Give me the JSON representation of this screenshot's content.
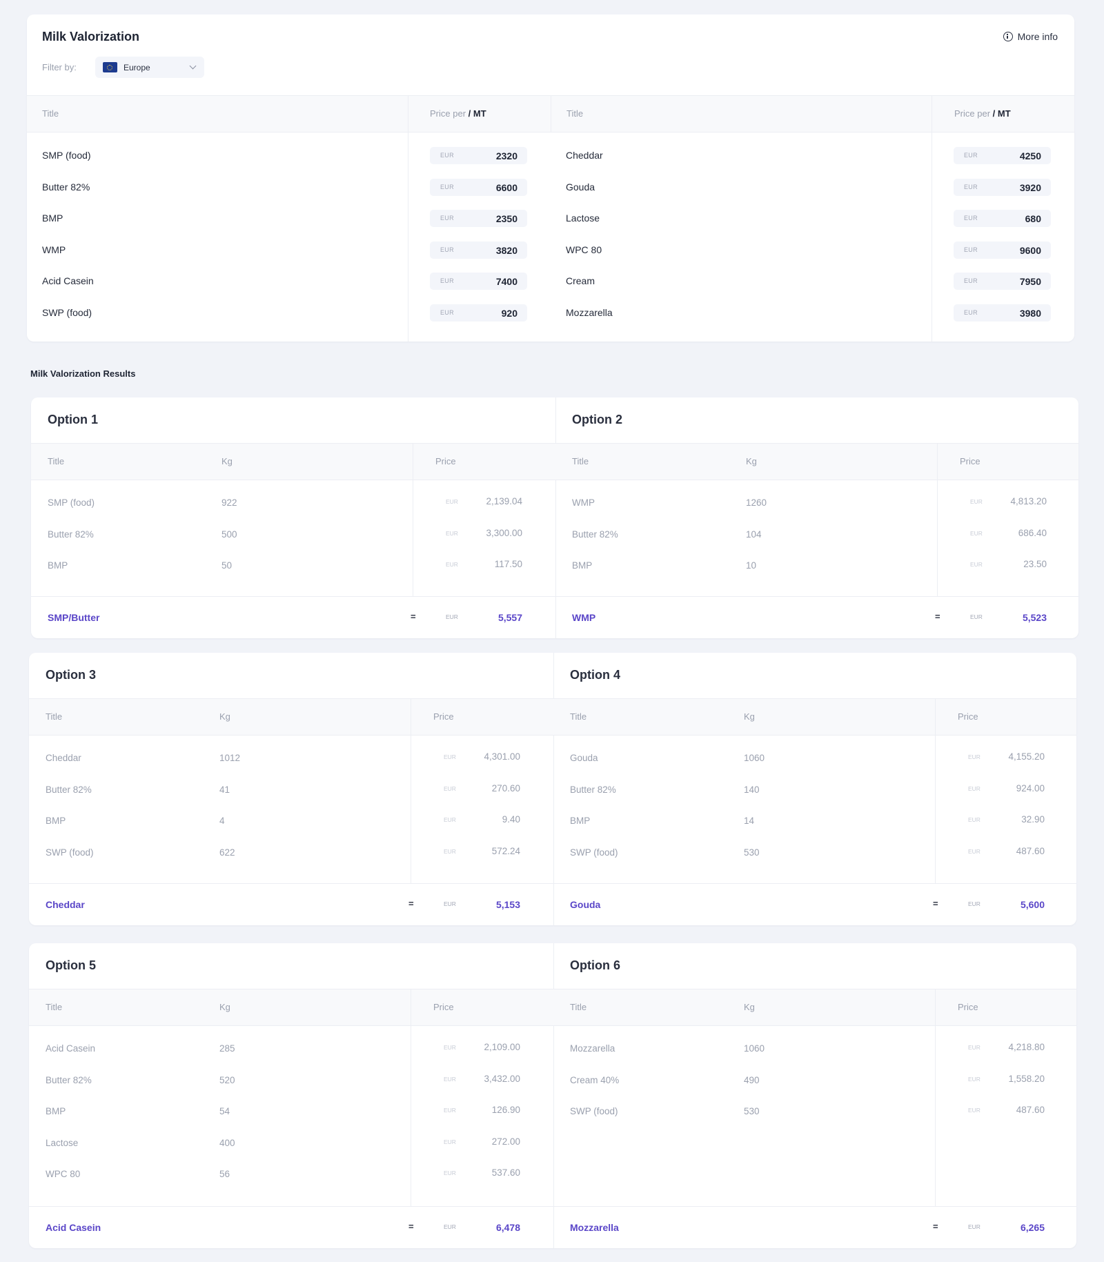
{
  "header": {
    "title": "Milk Valorization",
    "more_info": "More info",
    "filter_label": "Filter by:",
    "filter_value": "Europe",
    "filter_icon": "eu-flag-icon"
  },
  "price_tables": [
    {
      "title_header": "Title",
      "price_header_prefix": "Price per",
      "price_header_unit": "/ MT",
      "rows": [
        {
          "title": "SMP (food)",
          "currency": "EUR",
          "price": "2320"
        },
        {
          "title": "Butter 82%",
          "currency": "EUR",
          "price": "6600"
        },
        {
          "title": "BMP",
          "currency": "EUR",
          "price": "2350"
        },
        {
          "title": "WMP",
          "currency": "EUR",
          "price": "3820"
        },
        {
          "title": "Acid Casein",
          "currency": "EUR",
          "price": "7400"
        },
        {
          "title": "SWP (food)",
          "currency": "EUR",
          "price": "920"
        }
      ]
    },
    {
      "title_header": "Title",
      "price_header_prefix": "Price per",
      "price_header_unit": "/ MT",
      "rows": [
        {
          "title": "Cheddar",
          "currency": "EUR",
          "price": "4250"
        },
        {
          "title": "Gouda",
          "currency": "EUR",
          "price": "3920"
        },
        {
          "title": "Lactose",
          "currency": "EUR",
          "price": "680"
        },
        {
          "title": "WPC 80",
          "currency": "EUR",
          "price": "9600"
        },
        {
          "title": "Cream",
          "currency": "EUR",
          "price": "7950"
        },
        {
          "title": "Mozzarella",
          "currency": "EUR",
          "price": "3980"
        }
      ]
    }
  ],
  "results_heading": "Milk Valorization Results",
  "options": [
    {
      "name": "Option 1",
      "headers": {
        "title": "Title",
        "kg": "Kg",
        "price": "Price"
      },
      "rows": [
        {
          "title": "SMP (food)",
          "kg": "922",
          "currency": "EUR",
          "price": "2,139.04"
        },
        {
          "title": "Butter 82%",
          "kg": "500",
          "currency": "EUR",
          "price": "3,300.00"
        },
        {
          "title": "BMP",
          "kg": "50",
          "currency": "EUR",
          "price": "117.50"
        }
      ],
      "total": {
        "label": "SMP/Butter",
        "eq": "=",
        "currency": "EUR",
        "value": "5,557"
      }
    },
    {
      "name": "Option 2",
      "headers": {
        "title": "Title",
        "kg": "Kg",
        "price": "Price"
      },
      "rows": [
        {
          "title": "WMP",
          "kg": "1260",
          "currency": "EUR",
          "price": "4,813.20"
        },
        {
          "title": "Butter 82%",
          "kg": "104",
          "currency": "EUR",
          "price": "686.40"
        },
        {
          "title": "BMP",
          "kg": "10",
          "currency": "EUR",
          "price": "23.50"
        }
      ],
      "total": {
        "label": "WMP",
        "eq": "=",
        "currency": "EUR",
        "value": "5,523"
      }
    },
    {
      "name": "Option 3",
      "headers": {
        "title": "Title",
        "kg": "Kg",
        "price": "Price"
      },
      "rows": [
        {
          "title": "Cheddar",
          "kg": "1012",
          "currency": "EUR",
          "price": "4,301.00"
        },
        {
          "title": "Butter 82%",
          "kg": "41",
          "currency": "EUR",
          "price": "270.60"
        },
        {
          "title": "BMP",
          "kg": "4",
          "currency": "EUR",
          "price": "9.40"
        },
        {
          "title": "SWP (food)",
          "kg": "622",
          "currency": "EUR",
          "price": "572.24"
        }
      ],
      "total": {
        "label": "Cheddar",
        "eq": "=",
        "currency": "EUR",
        "value": "5,153"
      }
    },
    {
      "name": "Option 4",
      "headers": {
        "title": "Title",
        "kg": "Kg",
        "price": "Price"
      },
      "rows": [
        {
          "title": "Gouda",
          "kg": "1060",
          "currency": "EUR",
          "price": "4,155.20"
        },
        {
          "title": "Butter 82%",
          "kg": "140",
          "currency": "EUR",
          "price": "924.00"
        },
        {
          "title": "BMP",
          "kg": "14",
          "currency": "EUR",
          "price": "32.90"
        },
        {
          "title": "SWP (food)",
          "kg": "530",
          "currency": "EUR",
          "price": "487.60"
        }
      ],
      "total": {
        "label": "Gouda",
        "eq": "=",
        "currency": "EUR",
        "value": "5,600"
      }
    },
    {
      "name": "Option 5",
      "headers": {
        "title": "Title",
        "kg": "Kg",
        "price": "Price"
      },
      "rows": [
        {
          "title": "Acid Casein",
          "kg": "285",
          "currency": "EUR",
          "price": "2,109.00"
        },
        {
          "title": "Butter 82%",
          "kg": "520",
          "currency": "EUR",
          "price": "3,432.00"
        },
        {
          "title": "BMP",
          "kg": "54",
          "currency": "EUR",
          "price": "126.90"
        },
        {
          "title": "Lactose",
          "kg": "400",
          "currency": "EUR",
          "price": "272.00"
        },
        {
          "title": "WPC 80",
          "kg": "56",
          "currency": "EUR",
          "price": "537.60"
        }
      ],
      "total": {
        "label": "Acid Casein",
        "eq": "=",
        "currency": "EUR",
        "value": "6,478"
      }
    },
    {
      "name": "Option 6",
      "headers": {
        "title": "Title",
        "kg": "Kg",
        "price": "Price"
      },
      "rows": [
        {
          "title": "Mozzarella",
          "kg": "1060",
          "currency": "EUR",
          "price": "4,218.80"
        },
        {
          "title": "Cream 40%",
          "kg": "490",
          "currency": "EUR",
          "price": "1,558.20"
        },
        {
          "title": "SWP (food)",
          "kg": "530",
          "currency": "EUR",
          "price": "487.60"
        }
      ],
      "total": {
        "label": "Mozzarella",
        "eq": "=",
        "currency": "EUR",
        "value": "6,265"
      }
    }
  ]
}
